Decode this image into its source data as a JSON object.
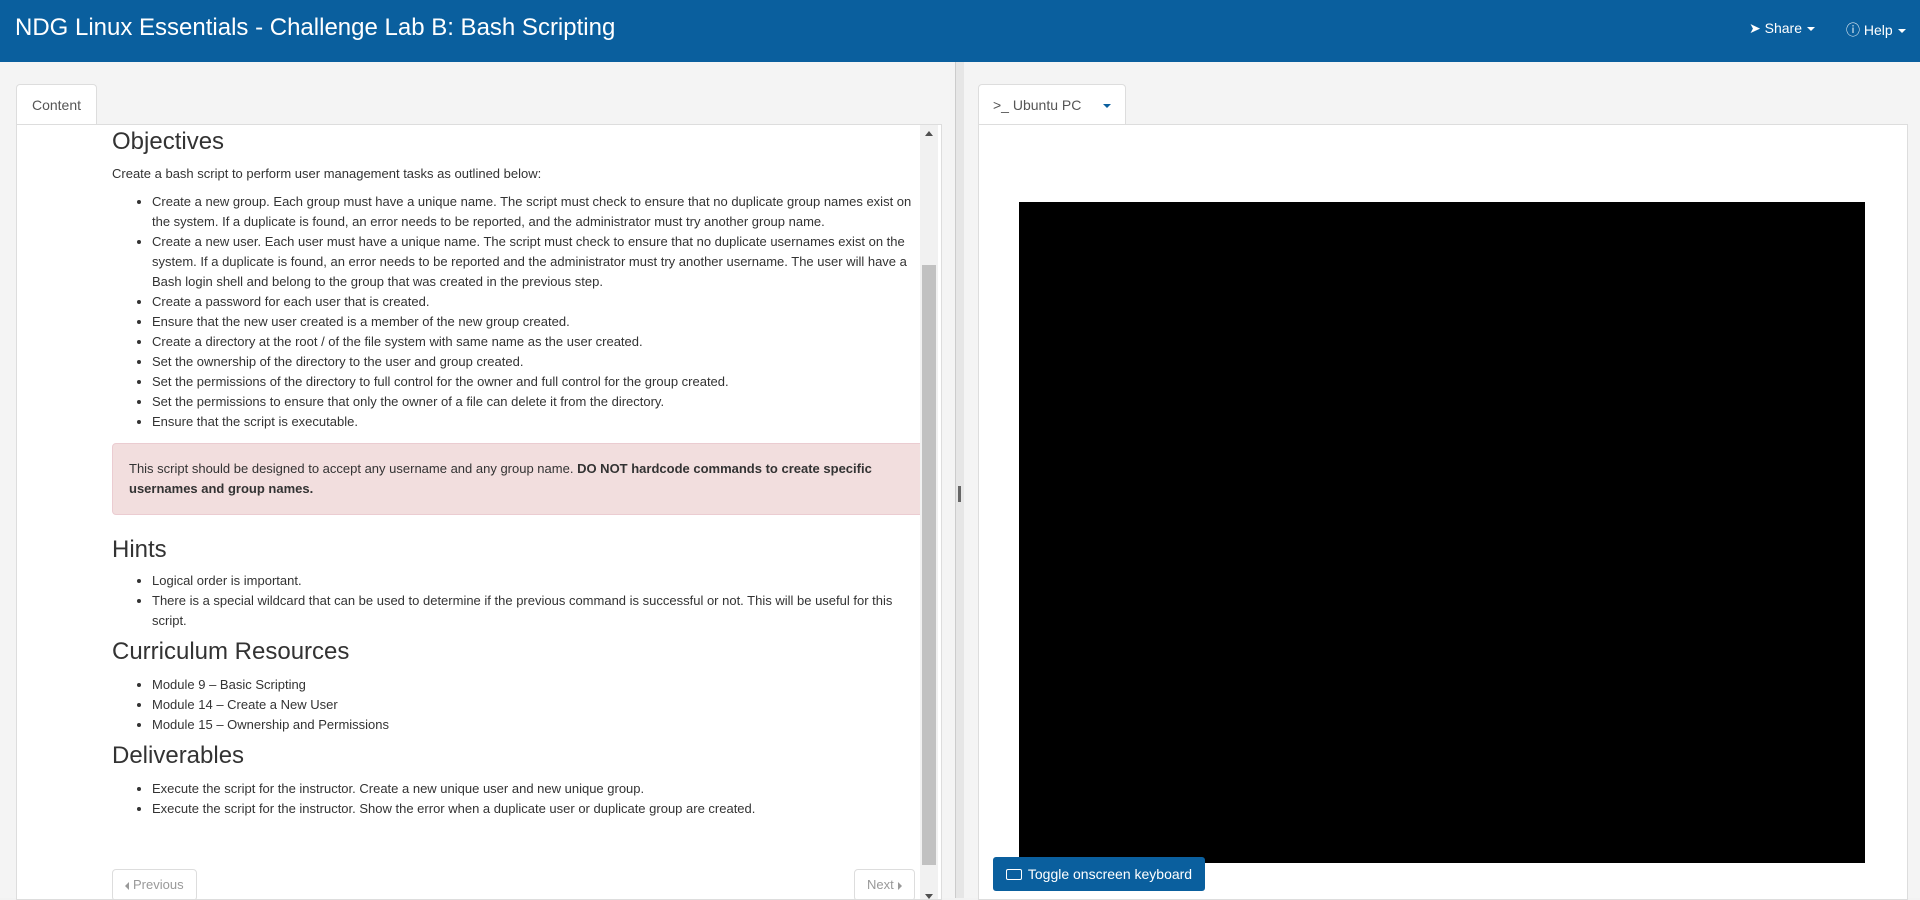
{
  "header": {
    "title": "NDG Linux Essentials - Challenge Lab B: Bash Scripting",
    "share_label": "Share",
    "help_label": "Help",
    "bg_color": "#0a5f9e"
  },
  "left": {
    "tab_label": "Content",
    "objectives": {
      "heading": "Objectives",
      "intro": "Create a bash script to perform user management tasks as outlined below:",
      "items": [
        "Create a new group. Each group must have a unique name. The script must check to ensure that no duplicate group names exist on the system. If a duplicate is found, an error needs to be reported, and the administrator must try another group name.",
        "Create a new user. Each user must have a unique name. The script must check to ensure that no duplicate usernames exist on the system. If a duplicate is found, an error needs to be reported and the administrator must try another username. The user will have a Bash login shell and belong to the group that was created in the previous step.",
        "Create a password for each user that is created.",
        "Ensure that the new user created is a member of the new group created.",
        "Create a directory at the root  /  of the file system with same name as the user created.",
        "Set the ownership of the directory to the user and group created.",
        "Set the permissions of the directory to full control for the owner and full control for the group created.",
        "Set the permissions to ensure that only the owner of a file can delete it from the directory.",
        "Ensure that the script is executable."
      ]
    },
    "alert": {
      "text": "This script should be designed to accept any username and any group name. ",
      "bold": "DO NOT hardcode commands to create specific usernames and group names."
    },
    "hints": {
      "heading": "Hints",
      "items": [
        "Logical order is important.",
        "There is a special wildcard that can be used to determine if the previous command is successful or not. This will be useful for this script."
      ]
    },
    "resources": {
      "heading": "Curriculum Resources",
      "items": [
        "Module 9 – Basic Scripting",
        "Module 14 – Create a New User",
        "Module 15 – Ownership and Permissions"
      ]
    },
    "deliverables": {
      "heading": "Deliverables",
      "items": [
        "Execute the script for the instructor. Create a new unique user and new unique group.",
        "Execute the script for the instructor. Show the error when a duplicate user or duplicate group are created."
      ]
    },
    "prev_label": "Previous",
    "next_label": "Next"
  },
  "right": {
    "tab_label": ">_ Ubuntu PC",
    "keyboard_button": "Toggle onscreen keyboard",
    "button_color": "#0a5f9e"
  }
}
